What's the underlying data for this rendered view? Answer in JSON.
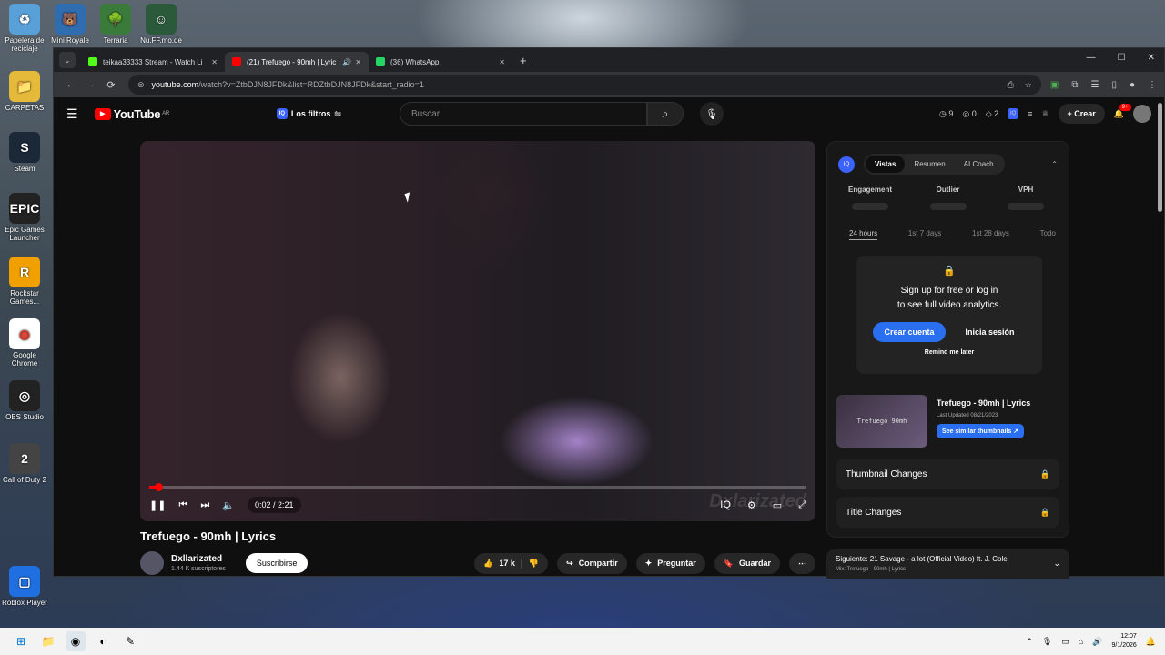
{
  "desktop": {
    "top_icons": [
      {
        "label": "Papelera de reciclaje",
        "glyph": "♻",
        "color": "#5aa0d8"
      },
      {
        "label": "Mini Royale",
        "glyph": "🐻",
        "color": "#2f6db0"
      },
      {
        "label": "Terraria",
        "glyph": "🌳",
        "color": "#3a7a3a"
      },
      {
        "label": "Nu.FF.mo.de",
        "glyph": "☺",
        "color": "#2a5a3a"
      }
    ],
    "side_icons": [
      {
        "label": "CARPETAS",
        "glyph": "📁",
        "color": "#e5b93a"
      },
      {
        "label": "Steam",
        "glyph": "S",
        "color": "#1b2838"
      },
      {
        "label": "Epic Games Launcher",
        "glyph": "EPIC",
        "color": "#222"
      },
      {
        "label": "Rockstar Games...",
        "glyph": "R",
        "color": "#f0a000"
      },
      {
        "label": "Google Chrome",
        "glyph": "◉",
        "color": "#fff"
      },
      {
        "label": "OBS Studio",
        "glyph": "◎",
        "color": "#222"
      },
      {
        "label": "Call of Duty 2",
        "glyph": "2",
        "color": "#444"
      },
      {
        "label": "Roblox Player",
        "glyph": "▢",
        "color": "#1f6fe0"
      }
    ]
  },
  "browser": {
    "tabs": [
      {
        "title": "teikaa33333 Stream - Watch Li",
        "fav_color": "#53fc18",
        "active": false
      },
      {
        "title": "(21) Trefuego - 90mh | Lyric",
        "fav_color": "#ff0000",
        "active": true
      },
      {
        "title": "(36) WhatsApp",
        "fav_color": "#25d366",
        "active": false
      }
    ],
    "url_host": "youtube.com",
    "url_path": "/watch?v=ZtbDJN8JFDk&list=RDZtbDJN8JFDk&start_radio=1"
  },
  "yt": {
    "logo": "YouTube",
    "region": "AR",
    "filters_label": "Los filtros",
    "search_placeholder": "Buscar",
    "counts": {
      "a": "9",
      "b": "0",
      "c": "2"
    },
    "create_label": "Crear",
    "notif_badge": "9+"
  },
  "player": {
    "time": "0:02 / 2:21",
    "progress": 0.014,
    "buffered": 0.14,
    "watermark": "Dxlarizated"
  },
  "video": {
    "title": "Trefuego - 90mh | Lyrics",
    "channel": "Dxllarizated",
    "subs": "1.44 K suscriptores",
    "subscribe": "Suscribirse",
    "likes": "17 k",
    "share": "Compartir",
    "ask": "Preguntar",
    "save": "Guardar"
  },
  "panel": {
    "tabs": [
      "Vistas",
      "Resumen",
      "AI Coach"
    ],
    "stats": [
      "Engagement",
      "Outlier",
      "VPH"
    ],
    "ranges": [
      "24 hours",
      "1st 7 days",
      "1st 28 days",
      "Todo"
    ],
    "lock_msg1": "Sign up for free or log in",
    "lock_msg2": "to see full video analytics.",
    "create_account": "Crear cuenta",
    "login": "Inicia sesión",
    "remind": "Remind me later",
    "thumb_text": "Trefuego 90mh",
    "thumb_title": "Trefuego - 90mh | Lyrics",
    "last_updated": "Last Updated 08/21/2023",
    "similar": "See similar thumbnails ↗",
    "thumb_changes": "Thumbnail Changes",
    "title_changes": "Title Changes"
  },
  "next": {
    "label": "Siguiente: 21 Savage - a lot (Official Video) ft. J. Cole",
    "mix": "Mix: Trefuego - 90mh | Lyrics"
  },
  "taskbar": {
    "time": "12:07",
    "date": "9/1/2026"
  }
}
